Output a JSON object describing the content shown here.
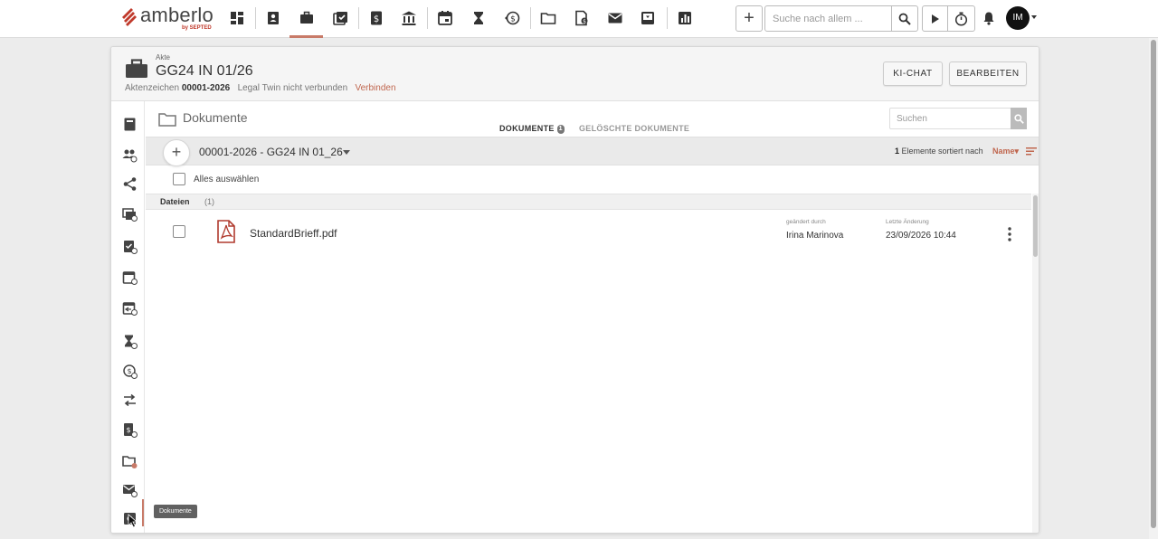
{
  "app": {
    "logo_text": "amberlo",
    "logo_sub": "by SEPTED"
  },
  "topbar": {
    "nav_icons": [
      "dashboard-icon",
      "contacts-icon",
      "briefcase-icon",
      "tasks-icon",
      "invoice-icon",
      "bank-icon",
      "calendar-icon",
      "hourglass-icon",
      "time-history-icon",
      "folder-icon",
      "folder-settings-icon",
      "mail-icon",
      "inbox-icon",
      "reports-icon"
    ],
    "search_placeholder": "Suche nach allem ...",
    "avatar_initials": "IM"
  },
  "matter": {
    "label": "Akte",
    "title": "GG24 IN 01/26",
    "ref_label": "Aktenzeichen",
    "ref_value": "00001-2026",
    "legal_twin_status": "Legal Twin nicht verbunden",
    "connect_link": "Verbinden"
  },
  "header_buttons": {
    "ai_chat": "KI-CHAT",
    "edit": "BEARBEITEN"
  },
  "rail": {
    "icons": [
      "notebook-icon",
      "people-icon",
      "share-icon",
      "screens-icon",
      "tasks-icon",
      "calendar-icon",
      "calendar-transfer-icon",
      "hourglass-icon",
      "money-history-icon",
      "transfer-icon",
      "invoice-icon",
      "documents-icon",
      "mail-icon",
      "settings-icon"
    ],
    "active": "documents-icon",
    "tooltip": "Dokumente"
  },
  "documents": {
    "title": "Dokumente",
    "tab_active": "DOKUMENTE",
    "tab_active_badge": "1",
    "tab_inactive": "GELÖSCHTE DOKUMENTE",
    "search_placeholder": "Suchen",
    "path": "00001-2026 - GG24 IN 01_26",
    "count": "1",
    "sort_text": "Elemente sortiert nach",
    "sort_field": "Name",
    "select_all": "Alles auswählen",
    "group_label": "Dateien",
    "group_count": "(1)",
    "files": [
      {
        "name": "StandardBrieff.pdf",
        "changed_by_label": "geändert durch",
        "changed_by": "Irina Marinova",
        "last_change_label": "Letzte Änderung",
        "last_change": "23/09/2026 10:44"
      }
    ]
  },
  "colors": {
    "accent": "#c87a68",
    "link": "#c0674f",
    "pdf_red": "#b03a2e"
  }
}
